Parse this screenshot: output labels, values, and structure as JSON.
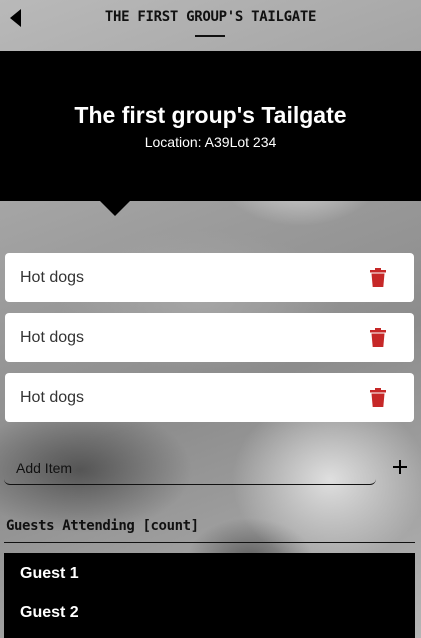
{
  "nav": {
    "title": "THE FIRST GROUP'S TAILGATE",
    "back_icon": "back-arrow-icon"
  },
  "hero": {
    "title": "The first group's Tailgate",
    "subtitle": "Location: A39Lot 234",
    "background_color": "#000000"
  },
  "items": [
    {
      "label": "Hot dogs",
      "delete_icon": "trash-icon"
    },
    {
      "label": "Hot dogs",
      "delete_icon": "trash-icon"
    },
    {
      "label": "Hot dogs",
      "delete_icon": "trash-icon"
    }
  ],
  "add_item": {
    "placeholder": "Add Item",
    "add_icon": "plus-icon"
  },
  "guests": {
    "heading": "Guests Attending [count]",
    "list": [
      "Guest 1",
      "Guest 2"
    ]
  },
  "colors": {
    "accent_delete": "#c62828",
    "card_background": "#ffffff",
    "list_background": "#000000"
  }
}
